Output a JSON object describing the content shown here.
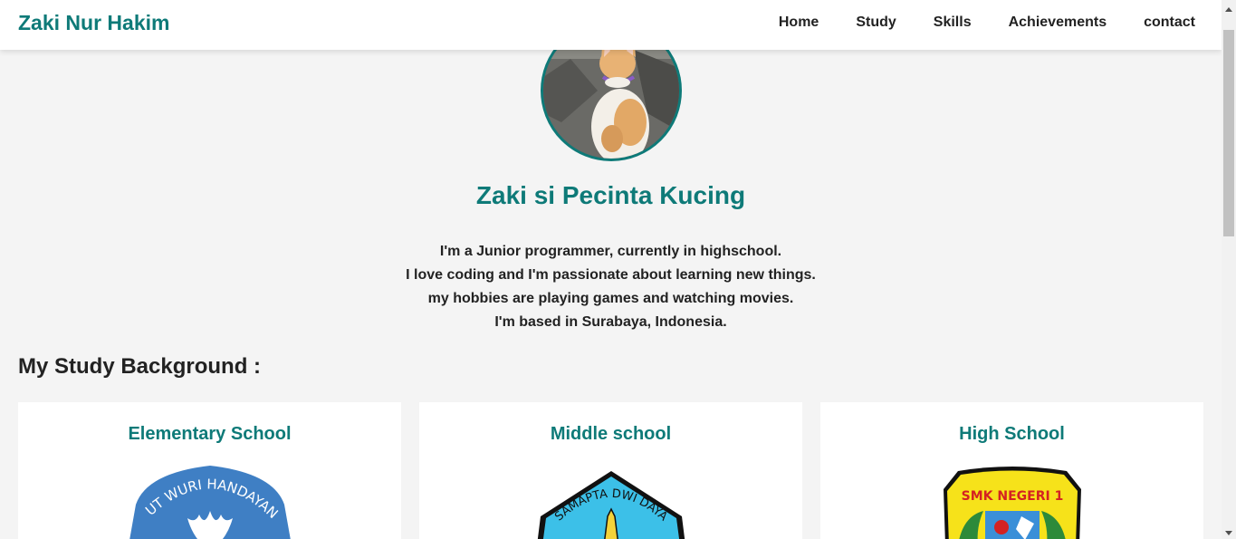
{
  "nav": {
    "brand": "Zaki Nur Hakim",
    "links": [
      "Home",
      "Study",
      "Skills",
      "Achievements",
      "contact"
    ]
  },
  "hero": {
    "title": "Zaki si Pecinta Kucing",
    "bio": [
      "I'm a Junior programmer, currently in highschool.",
      "I love coding and I'm passionate about learning new things.",
      "my hobbies are playing games and watching movies.",
      "I'm based in Surabaya, Indonesia."
    ]
  },
  "study": {
    "heading": "My Study Background :",
    "cards": [
      {
        "title": "Elementary School",
        "logo_text": "TUT WURI HANDAYANI"
      },
      {
        "title": "Middle school",
        "logo_text": "SAMAPTA DWI DAYA"
      },
      {
        "title": "High School",
        "logo_text": "SMK NEGERI 1"
      }
    ]
  },
  "colors": {
    "accent": "#0e7a78",
    "background": "#f4f4f4"
  }
}
